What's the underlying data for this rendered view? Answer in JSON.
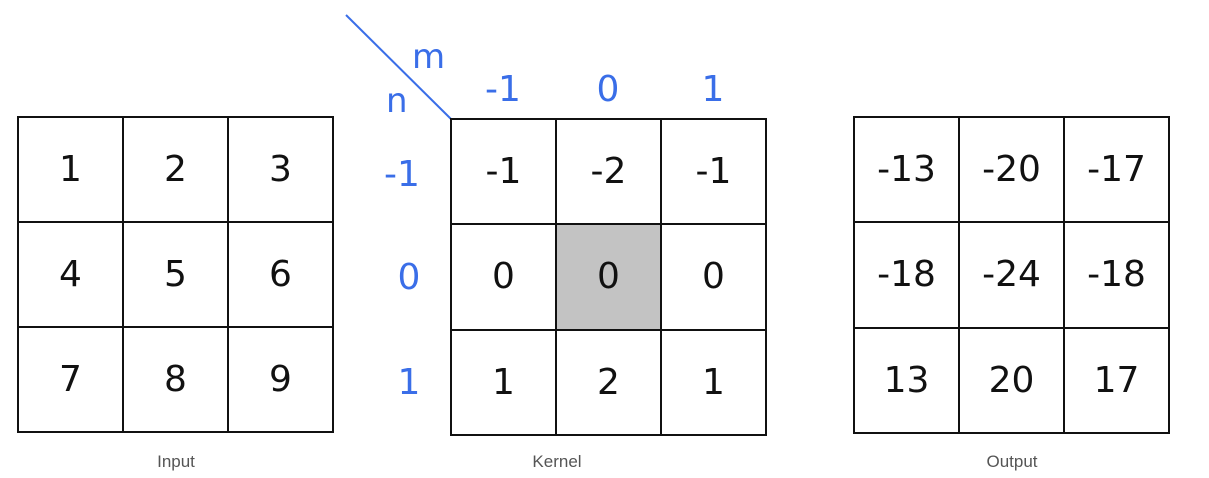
{
  "input": {
    "caption": "Input",
    "cells": [
      "1",
      "2",
      "3",
      "4",
      "5",
      "6",
      "7",
      "8",
      "9"
    ]
  },
  "kernel": {
    "caption": "Kernel",
    "cells": [
      "-1",
      "-2",
      "-1",
      "0",
      "0",
      "0",
      "1",
      "2",
      "1"
    ],
    "highlighted_cell": 4,
    "highlight_color": "#c3c3c3",
    "column_axis_label": "m",
    "row_axis_label": "n",
    "column_indices": [
      "-1",
      "0",
      "1"
    ],
    "row_indices": [
      "-1",
      "0",
      "1"
    ]
  },
  "output": {
    "caption": "Output",
    "cells": [
      "-13",
      "-20",
      "-17",
      "-18",
      "-24",
      "-18",
      "13",
      "20",
      "17"
    ]
  },
  "colors": {
    "index_blue": "#3a6ee8",
    "grid_line": "#111111"
  }
}
